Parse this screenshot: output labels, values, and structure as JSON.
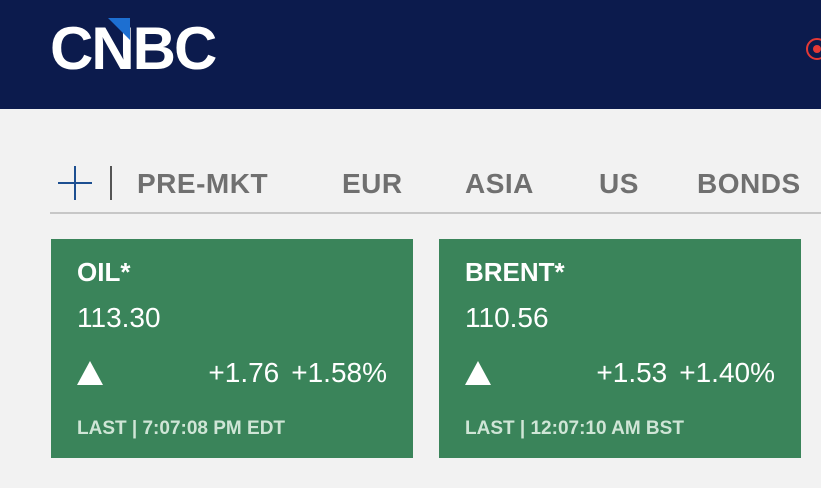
{
  "header": {
    "logo_text": "CNBC",
    "background_color": "#0c1b4d"
  },
  "tabs": {
    "items": [
      "PRE-MKT",
      "EUR",
      "ASIA",
      "US",
      "BONDS"
    ]
  },
  "quotes": [
    {
      "name": "OIL*",
      "price": "113.30",
      "direction": "up",
      "change": "+1.76",
      "change_pct": "+1.58%",
      "last_label": "LAST | 7:07:08 PM EDT"
    },
    {
      "name": "BRENT*",
      "price": "110.56",
      "direction": "up",
      "change": "+1.53",
      "change_pct": "+1.40%",
      "last_label": "LAST | 12:07:10 AM BST"
    }
  ],
  "colors": {
    "card_up": "#3a845a",
    "accent_blue": "#1d4f91"
  },
  "icons": [
    "cnbc-logo",
    "plus-icon",
    "up-triangle-icon",
    "live-icon"
  ]
}
